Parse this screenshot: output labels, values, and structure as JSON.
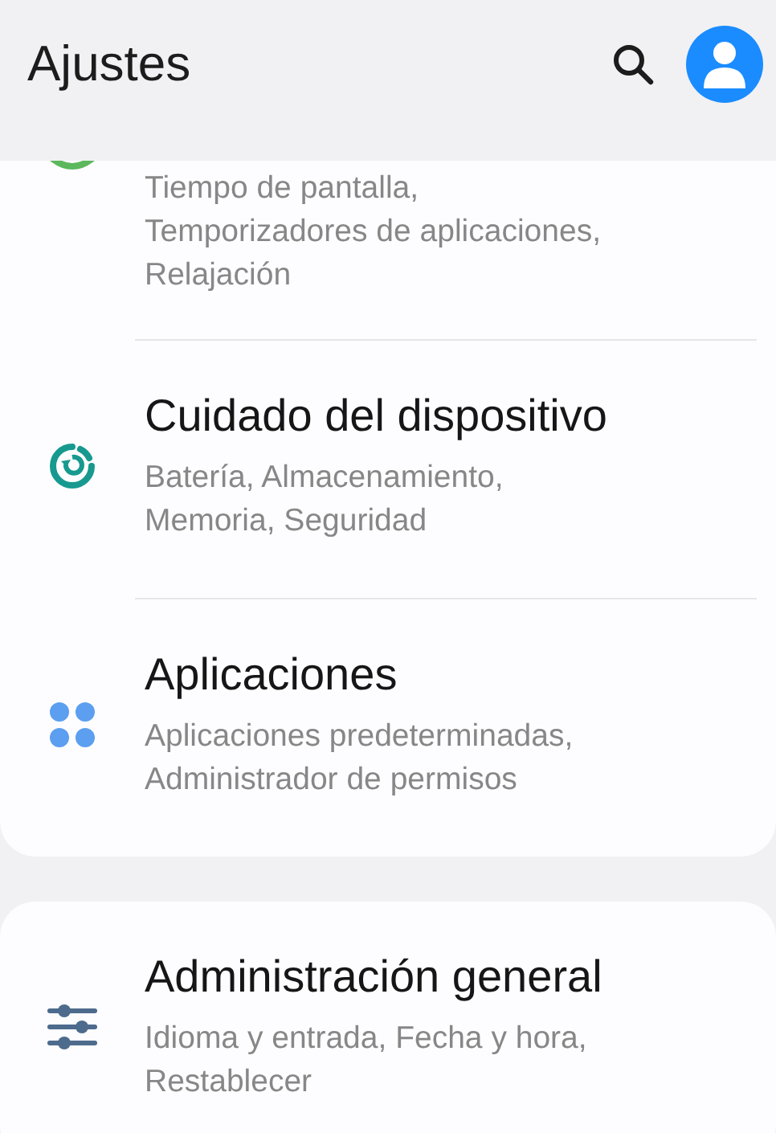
{
  "header": {
    "title": "Ajustes"
  },
  "groups": [
    {
      "items": [
        {
          "kind": "timer",
          "lines": [
            "Tiempo de pantalla,",
            "Temporizadores de aplicaciones,",
            "Relajación"
          ]
        },
        {
          "kind": "device-care",
          "title": "Cuidado del dispositivo",
          "lines": [
            "Batería, Almacenamiento,",
            "Memoria, Seguridad"
          ]
        },
        {
          "kind": "apps",
          "title": "Aplicaciones",
          "lines": [
            "Aplicaciones predeterminadas,",
            "Administrador de permisos"
          ]
        }
      ]
    },
    {
      "items": [
        {
          "kind": "sliders",
          "title": "Administración general",
          "lines": [
            "Idioma y entrada, Fecha y hora,",
            "Restablecer"
          ]
        }
      ]
    }
  ]
}
